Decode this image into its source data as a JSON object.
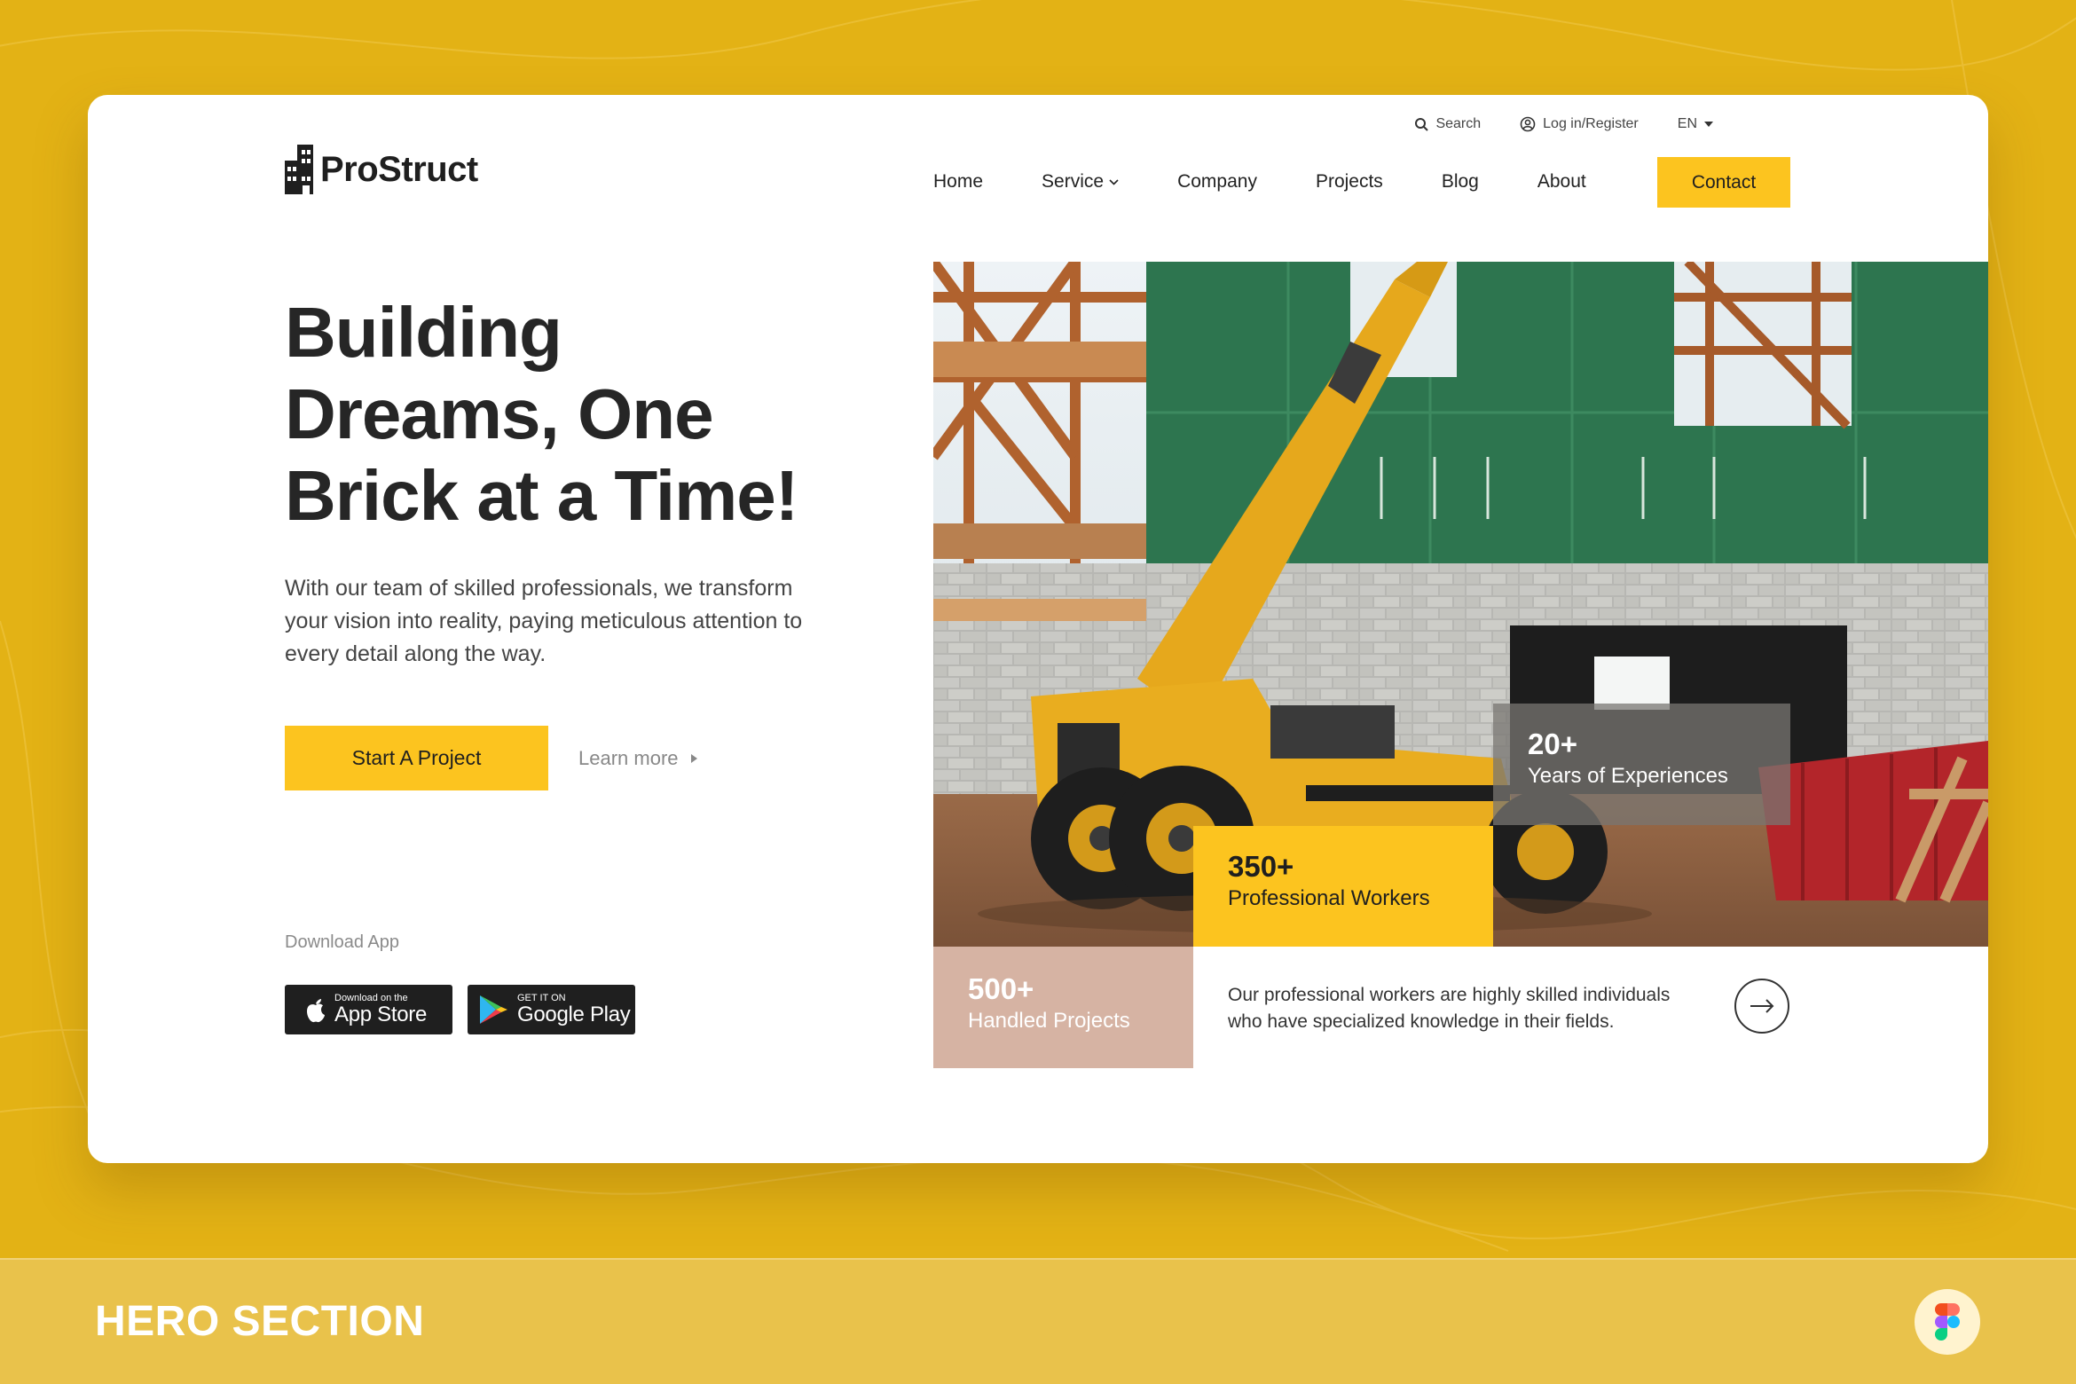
{
  "header": {
    "logo_text": "ProStruct",
    "utility": {
      "search_label": "Search",
      "login_label": "Log in/Register",
      "language": "EN"
    },
    "nav": [
      {
        "label": "Home"
      },
      {
        "label": "Service"
      },
      {
        "label": "Company"
      },
      {
        "label": "Projects"
      },
      {
        "label": "Blog"
      },
      {
        "label": "About"
      }
    ],
    "contact_label": "Contact"
  },
  "hero": {
    "headline_lines": [
      "Building",
      "Dreams, One",
      "Brick at a Time!"
    ],
    "subtext": "With our team of skilled professionals, we transform your vision into reality, paying meticulous attention to every detail along the way.",
    "primary_cta": "Start A Project",
    "secondary_cta": "Learn more",
    "download_label": "Download App",
    "app_store": {
      "small": "Download on the",
      "big": "App Store"
    },
    "google_play": {
      "small": "GET IT ON",
      "big": "Google Play"
    }
  },
  "stats": {
    "experience": {
      "value": "20+",
      "label": "Years of Experiences"
    },
    "workers": {
      "value": "350+",
      "label": "Professional Workers"
    },
    "projects": {
      "value": "500+",
      "label": "Handled Projects"
    }
  },
  "description": "Our professional workers are highly skilled individuals who have specialized knowledge in their fields.",
  "footer": {
    "title": "HERO SECTION"
  },
  "colors": {
    "accent": "#fcc41f",
    "background": "#e3b215",
    "dark": "#1f1f1f"
  }
}
